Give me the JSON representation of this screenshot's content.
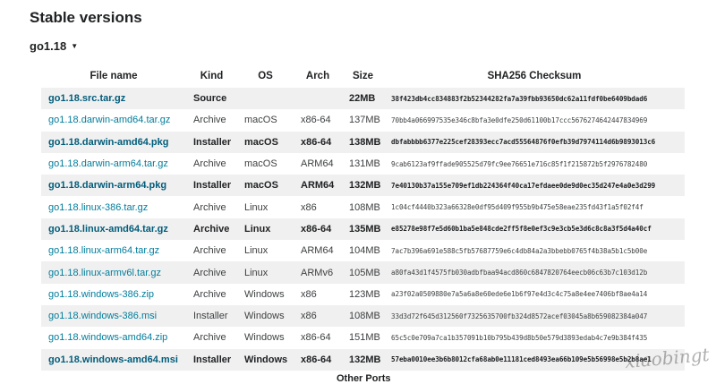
{
  "section_title": "Stable versions",
  "version": {
    "label": "go1.18",
    "caret": "▼"
  },
  "columns": [
    "File name",
    "Kind",
    "OS",
    "Arch",
    "Size",
    "SHA256 Checksum"
  ],
  "files": [
    {
      "name": "go1.18.src.tar.gz",
      "kind": "Source",
      "os": "",
      "arch": "",
      "size": "22MB",
      "sha": "38f423db4cc834883f2b52344282fa7a39fbb93650dc62a11fdf0be6409bdad6",
      "primary": true
    },
    {
      "name": "go1.18.darwin-amd64.tar.gz",
      "kind": "Archive",
      "os": "macOS",
      "arch": "x86-64",
      "size": "137MB",
      "sha": "70bb4a066997535e346c8bfa3e0dfe250d61100b17ccc5676274642447834969",
      "primary": false
    },
    {
      "name": "go1.18.darwin-amd64.pkg",
      "kind": "Installer",
      "os": "macOS",
      "arch": "x86-64",
      "size": "138MB",
      "sha": "dbfabbbb6377e225cef28393ecc7acd55564876f0efb39d7974114d6b9893013c6",
      "primary": true
    },
    {
      "name": "go1.18.darwin-arm64.tar.gz",
      "kind": "Archive",
      "os": "macOS",
      "arch": "ARM64",
      "size": "131MB",
      "sha": "9cab6123af9ffade905525d79fc9ee76651e716c85f1f215872b5f2976782480",
      "primary": false
    },
    {
      "name": "go1.18.darwin-arm64.pkg",
      "kind": "Installer",
      "os": "macOS",
      "arch": "ARM64",
      "size": "132MB",
      "sha": "7e40130b37a155e709ef1db224364f40ca17efdaee0de9d0ec35d247e4a0e3d299",
      "primary": true
    },
    {
      "name": "go1.18.linux-386.tar.gz",
      "kind": "Archive",
      "os": "Linux",
      "arch": "x86",
      "size": "108MB",
      "sha": "1c04cf4440b323a66328e0df95d409f955b9b475e58eae235fd43f1a5f02f4f",
      "primary": false
    },
    {
      "name": "go1.18.linux-amd64.tar.gz",
      "kind": "Archive",
      "os": "Linux",
      "arch": "x86-64",
      "size": "135MB",
      "sha": "e85278e98f7e5d60b1ba5e848cde2ff5f8e0ef3c9e3cb5e3d6c8c8a3f5d4a40cf",
      "primary": true
    },
    {
      "name": "go1.18.linux-arm64.tar.gz",
      "kind": "Archive",
      "os": "Linux",
      "arch": "ARM64",
      "size": "104MB",
      "sha": "7ac7b396a691e588c5fb57687759e6c4db84a2a3bbebb0765f4b38a5b1c5b00e",
      "primary": false
    },
    {
      "name": "go1.18.linux-armv6l.tar.gz",
      "kind": "Archive",
      "os": "Linux",
      "arch": "ARMv6",
      "size": "105MB",
      "sha": "a80fa43d1f4575fb030adbfbaa94acd860c6847820764eecb06c63b7c103d12b",
      "primary": false
    },
    {
      "name": "go1.18.windows-386.zip",
      "kind": "Archive",
      "os": "Windows",
      "arch": "x86",
      "size": "123MB",
      "sha": "a23f02a0509880e7a5a6a8e60ede6e1b6f97e4d3c4c75a8e4ee7406bf8ae4a14",
      "primary": false
    },
    {
      "name": "go1.18.windows-386.msi",
      "kind": "Installer",
      "os": "Windows",
      "arch": "x86",
      "size": "108MB",
      "sha": "33d3d72f645d312560f7325635700fb324d8572acef03045a8b659082384a047",
      "primary": false
    },
    {
      "name": "go1.18.windows-amd64.zip",
      "kind": "Archive",
      "os": "Windows",
      "arch": "x86-64",
      "size": "151MB",
      "sha": "65c5c0e709a7ca1b357091b10b795b439d8b50e579d3893edab4c7e9b384f435",
      "primary": false
    },
    {
      "name": "go1.18.windows-amd64.msi",
      "kind": "Installer",
      "os": "Windows",
      "arch": "x86-64",
      "size": "132MB",
      "sha": "57eba0010ee3b6b8012cfa68ab0e11181ced8493ea66b109e5b56998e5b2b8ae1",
      "primary": true
    }
  ],
  "other_ports_label": "Other Ports",
  "watermark": "xiaobingt",
  "colors": {
    "link": "#007d9c",
    "link_primary": "#005c7a",
    "row_stripe": "#f0f0f0",
    "text": "#202224"
  }
}
